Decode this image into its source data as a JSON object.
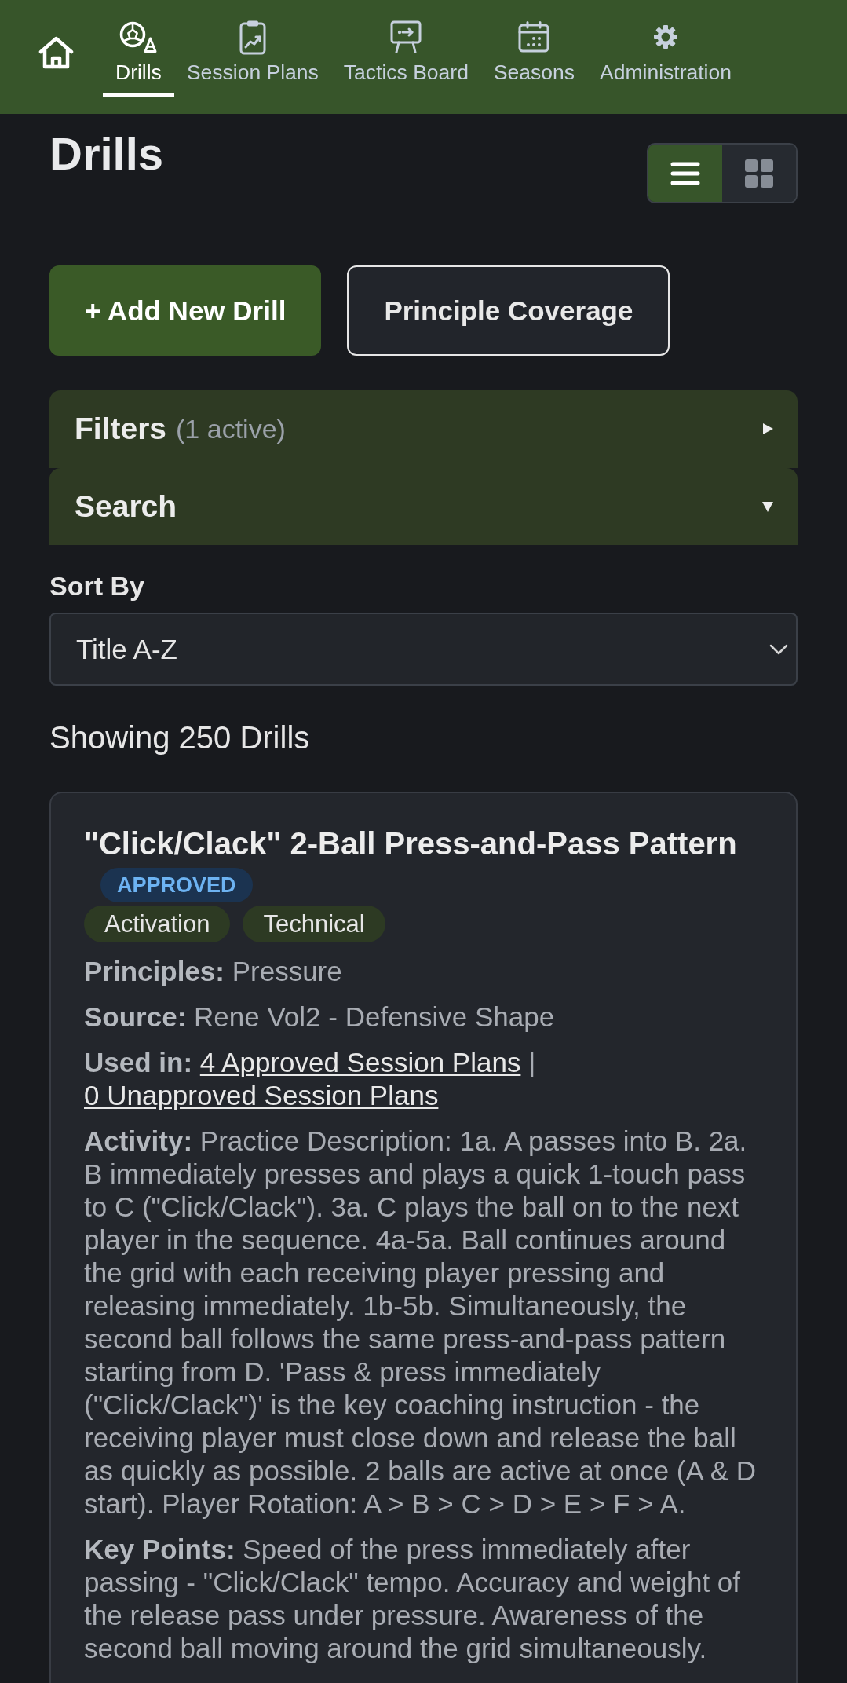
{
  "nav": {
    "items": [
      {
        "label": "Drills",
        "selected": true
      },
      {
        "label": "Session Plans",
        "selected": false
      },
      {
        "label": "Tactics Board",
        "selected": false
      },
      {
        "label": "Seasons",
        "selected": false
      },
      {
        "label": "Administration",
        "selected": false
      }
    ]
  },
  "page": {
    "title": "Drills"
  },
  "view_toggle": [
    {
      "selected": true
    },
    {
      "selected": false
    }
  ],
  "actions": [
    {
      "label": "+ Add New Drill",
      "kind": "primary"
    },
    {
      "label": "Principle Coverage",
      "kind": "outline"
    }
  ],
  "panels": [
    {
      "title": "Filters",
      "note": "(1 active)",
      "expanded": false
    },
    {
      "title": "Search",
      "expanded": true
    }
  ],
  "sort": {
    "label": "Sort By",
    "value": "Title A-Z"
  },
  "result_count": "Showing 250 Drills",
  "drills": [
    {
      "title": "\"Click/Clack\" 2-Ball Press-and-Pass Pattern",
      "status": {
        "label": "APPROVED",
        "kind": "approved"
      },
      "tags": [
        "Activation",
        "Technical"
      ],
      "fields": [
        {
          "kind": "text",
          "label": "Principles:",
          "text": "Pressure"
        },
        {
          "kind": "text",
          "label": "Source:",
          "text": "Rene Vol2 - Defensive Shape"
        },
        {
          "kind": "links",
          "label": "Used in:",
          "links": [
            "4 Approved Session Plans",
            "0 Unapproved Session Plans"
          ],
          "separator": "|"
        },
        {
          "kind": "text",
          "label": "Activity:",
          "text": "Practice Description: 1a. A passes into B. 2a. B immediately presses and plays a quick 1-touch pass to C (\"Click/Clack\"). 3a. C plays the ball on to the next player in the sequence. 4a-5a. Ball continues around the grid with each receiving player pressing and releasing immediately. 1b-5b. Simultaneously, the second ball follows the same press-and-pass pattern starting from D. 'Pass & press immediately (\"Click/Clack\")' is the key coaching instruction - the receiving player must close down and release the ball as quickly as possible. 2 balls are active at once (A & D start). Player Rotation: A > B > C > D > E > F > A."
        },
        {
          "kind": "text",
          "label": "Key Points:",
          "text": "Speed of the press immediately after passing - \"Click/Clack\" tempo. Accuracy and weight of the release pass under pressure. Awareness of the second ball moving around the grid simultaneously."
        }
      ]
    }
  ]
}
